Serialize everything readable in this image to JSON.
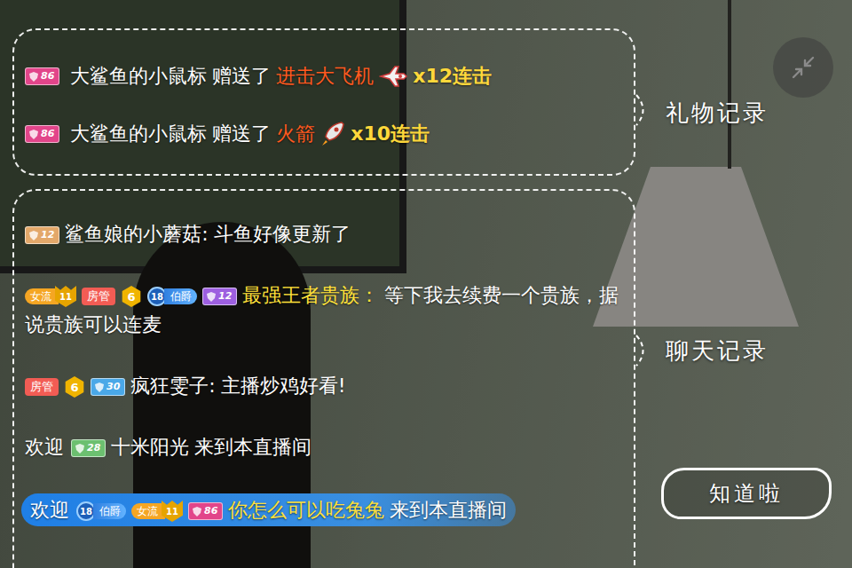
{
  "gift_log": {
    "label": "礼物记录",
    "items": [
      {
        "fan_badge": {
          "level": "86",
          "color": "#e2458a"
        },
        "user": "大鲨鱼的小鼠标",
        "verb": "赠送了",
        "gift": "进击大飞机",
        "kind": "plane",
        "combo": "x12连击"
      },
      {
        "fan_badge": {
          "level": "86",
          "color": "#e2458a"
        },
        "user": "大鲨鱼的小鼠标",
        "verb": "赠送了",
        "gift": "火箭",
        "kind": "rocket",
        "combo": "x10连击"
      }
    ]
  },
  "chat_log": {
    "label": "聊天记录",
    "messages": [
      {
        "kind": "chat",
        "badges": [
          {
            "kind": "fan",
            "level": "12",
            "color": "#e3a86a"
          }
        ],
        "user": "鲨鱼娘的小蘑菇:",
        "text": "斗鱼好像更新了",
        "highlight": false
      },
      {
        "kind": "chat",
        "badges": [
          {
            "kind": "streamer",
            "text": "女流",
            "level": "11"
          },
          {
            "kind": "tag",
            "text": "房管",
            "color": "#f25c54"
          },
          {
            "kind": "rank",
            "level": "6"
          },
          {
            "kind": "noble",
            "text": "伯爵",
            "level": "18"
          },
          {
            "kind": "fan",
            "level": "12",
            "color": "#9d5fe0"
          }
        ],
        "user": "最强王者贵族：",
        "text": "等下我去续费一个贵族，据说贵族可以连麦",
        "highlight": true
      },
      {
        "kind": "chat",
        "badges": [
          {
            "kind": "tag",
            "text": "房管",
            "color": "#f25c54"
          },
          {
            "kind": "rank",
            "level": "6"
          },
          {
            "kind": "fan",
            "level": "30",
            "color": "#4aa8e8"
          }
        ],
        "user": "疯狂雯子:",
        "text": "主播炒鸡好看!",
        "highlight": false
      },
      {
        "kind": "welcome",
        "prefix": "欢迎",
        "badges": [
          {
            "kind": "fan",
            "level": "28",
            "color": "#6cc070"
          }
        ],
        "user": "十米阳光",
        "suffix": "来到本直播间",
        "highlight": false
      },
      {
        "kind": "welcome-highlight",
        "prefix": "欢迎",
        "badges": [
          {
            "kind": "noble",
            "text": "伯爵",
            "level": "18"
          },
          {
            "kind": "streamer",
            "text": "女流",
            "level": "11"
          },
          {
            "kind": "fan",
            "level": "86",
            "color": "#e2458a"
          }
        ],
        "user": "你怎么可以吃兔兔",
        "suffix": "来到本直播间",
        "highlight": true
      }
    ]
  },
  "dismiss_button": "知道啦"
}
